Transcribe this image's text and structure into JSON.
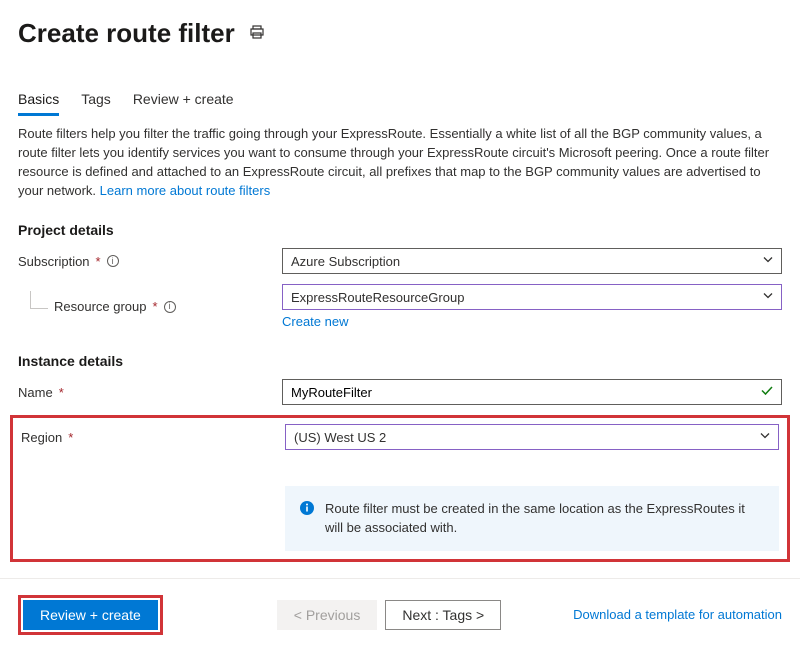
{
  "header": {
    "title": "Create route filter"
  },
  "tabs": {
    "basics": "Basics",
    "tags": "Tags",
    "review": "Review + create"
  },
  "description": {
    "text": "Route filters help you filter the traffic going through your ExpressRoute. Essentially a white list of all the BGP community values, a route filter lets you identify services you want to consume through your ExpressRoute circuit's Microsoft peering. Once a route filter resource is defined and attached to an ExpressRoute circuit, all prefixes that map to the BGP community values are advertised to your network.  ",
    "learn_link": "Learn more about route filters"
  },
  "sections": {
    "project": {
      "heading": "Project details",
      "subscription": {
        "label": "Subscription",
        "value": "Azure Subscription"
      },
      "resource_group": {
        "label": "Resource group",
        "value": "ExpressRouteResourceGroup",
        "create_new": "Create new"
      }
    },
    "instance": {
      "heading": "Instance details",
      "name": {
        "label": "Name",
        "value": "MyRouteFilter"
      },
      "region": {
        "label": "Region",
        "value": "(US) West US 2"
      },
      "info_text": "Route filter must be created in the same location as the ExpressRoutes it will be associated with."
    }
  },
  "footer": {
    "review_create": "Review + create",
    "previous": "< Previous",
    "next": "Next : Tags >",
    "download": "Download a template for automation"
  }
}
